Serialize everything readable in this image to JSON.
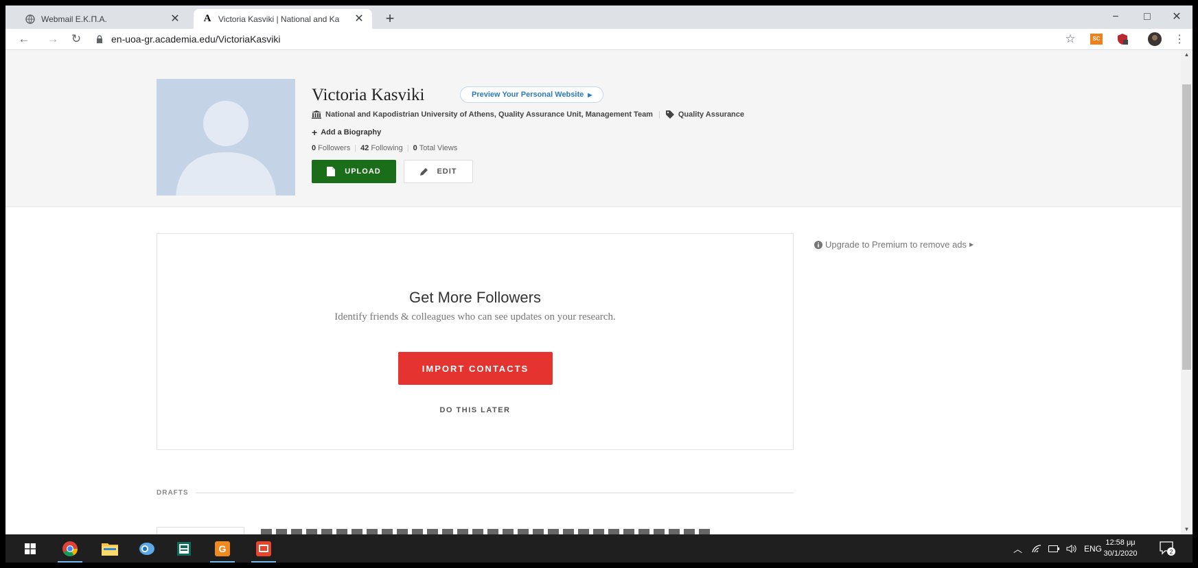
{
  "browser": {
    "tabs": [
      {
        "title": "Webmail Ε.Κ.Π.Α.",
        "active": false
      },
      {
        "title": "Victoria Kasviki | National and Ka",
        "active": true
      }
    ],
    "new_tab": "+",
    "url": "en-uoa-gr.academia.edu/VictoriaKasviki",
    "window_controls": {
      "minimize": "−",
      "maximize": "□",
      "close": "✕"
    },
    "extensions": [
      {
        "icon": "sc-extension-icon",
        "label": "SC"
      },
      {
        "icon": "shield-extension-icon"
      },
      {
        "icon": "profile-avatar-icon"
      }
    ]
  },
  "profile": {
    "name": "Victoria Kasviki",
    "preview_website": "Preview Your Personal Website",
    "affiliation": "National and Kapodistrian University of Athens, Quality Assurance Unit, Management Team",
    "research_tag": "Quality Assurance",
    "add_biography": "Add a Biography",
    "stats": {
      "followers_count": "0",
      "followers_label": "Followers",
      "following_count": "42",
      "following_label": "Following",
      "views_count": "0",
      "views_label": "Total Views"
    },
    "upload_label": "UPLOAD",
    "edit_label": "EDIT"
  },
  "followers_card": {
    "title": "Get More Followers",
    "subtitle": "Identify friends & colleagues who can see updates on your research.",
    "import_button": "IMPORT CONTACTS",
    "later_button": "DO THIS LATER"
  },
  "sidebar": {
    "premium_text": "Upgrade to Premium to remove ads"
  },
  "drafts": {
    "label": "DRAFTS"
  },
  "taskbar": {
    "apps": [
      "windows-start",
      "chrome",
      "file-explorer",
      "outlook",
      "publisher",
      "ginger",
      "scan-app"
    ],
    "language": "ENG",
    "time": "12:58 μμ",
    "date": "30/1/2020",
    "notifications": "2"
  },
  "colors": {
    "upload_green": "#1a6e1a",
    "import_red": "#e5342f",
    "link_blue": "#2a7ac0",
    "avatar_bg": "#c5d3e6"
  }
}
